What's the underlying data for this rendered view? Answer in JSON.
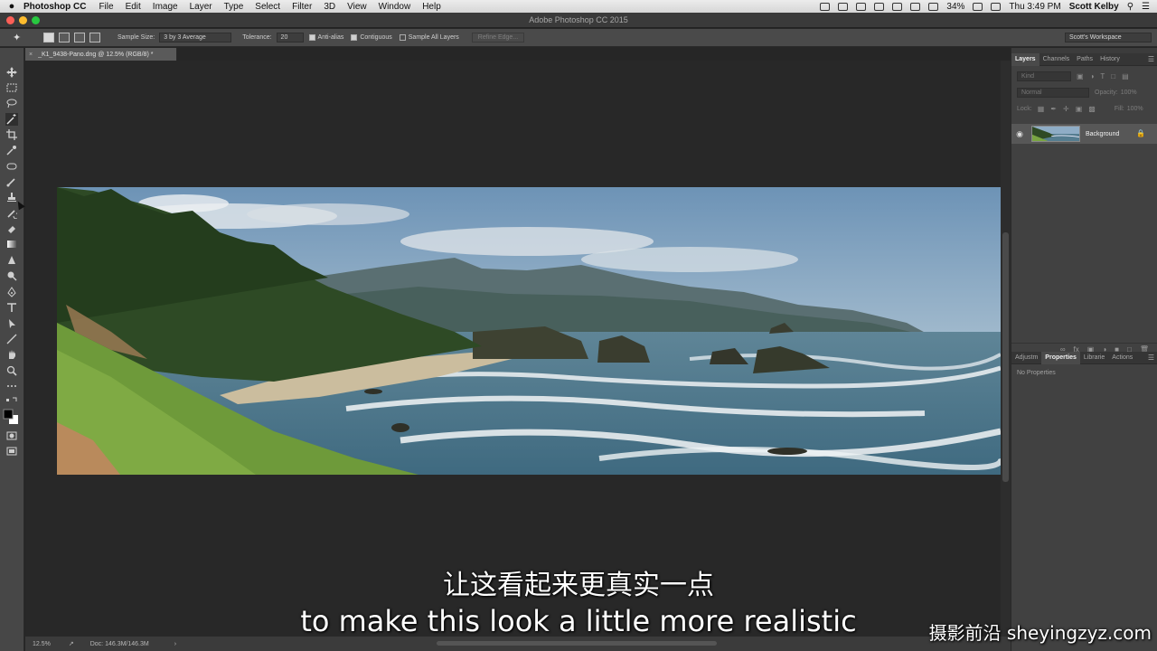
{
  "menubar": {
    "app_name": "Photoshop CC",
    "items": [
      "File",
      "Edit",
      "Image",
      "Layer",
      "Type",
      "Select",
      "Filter",
      "3D",
      "View",
      "Window",
      "Help"
    ],
    "battery": "34%",
    "clock": "Thu 3:49 PM",
    "user": "Scott Kelby"
  },
  "window": {
    "title": "Adobe Photoshop CC 2015"
  },
  "options": {
    "sample_size_label": "Sample Size:",
    "sample_size_value": "3 by 3 Average",
    "tolerance_label": "Tolerance:",
    "tolerance_value": "20",
    "anti_alias": "Anti-alias",
    "contiguous": "Contiguous",
    "sample_all_layers": "Sample All Layers",
    "refine_edge": "Refine Edge...",
    "workspace": "Scott's Workspace"
  },
  "document": {
    "tab_label": "_K1_9438-Pano.dng @ 12.5% (RGB/8) *"
  },
  "status": {
    "zoom": "12.5%",
    "doc_size": "Doc: 146.3M/146.3M"
  },
  "layers_panel": {
    "tabs": [
      "Layers",
      "Channels",
      "Paths",
      "History"
    ],
    "kind_placeholder": "Kind",
    "blend_mode": "Normal",
    "opacity_label": "Opacity:",
    "opacity_value": "100%",
    "lock_label": "Lock:",
    "fill_label": "Fill:",
    "fill_value": "100%",
    "layer_name": "Background"
  },
  "properties_panel": {
    "tabs": [
      "Adjustm",
      "Properties",
      "Librarie",
      "Actions"
    ],
    "empty_text": "No Properties"
  },
  "subtitles": {
    "chinese": "让这看起来更真实一点",
    "english": "to make this look a little more realistic",
    "watermark": "摄影前沿 sheyingzyz.com"
  },
  "colors": {
    "accent_red": "#fc5f57",
    "accent_yellow": "#fdbc2e",
    "accent_green": "#28c840"
  }
}
